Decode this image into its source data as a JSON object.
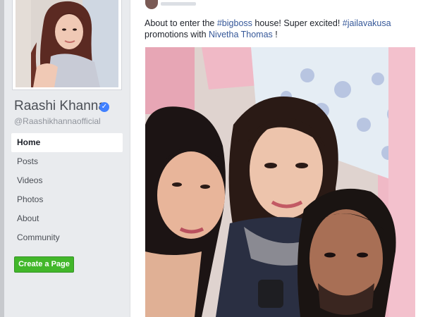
{
  "profile": {
    "name": "Raashi Khanna",
    "handle": "@Raashikhannaofficial",
    "verified_icon": "verified-badge-icon"
  },
  "nav": {
    "items": [
      {
        "label": "Home",
        "active": true
      },
      {
        "label": "Posts"
      },
      {
        "label": "Videos"
      },
      {
        "label": "Photos"
      },
      {
        "label": "About"
      },
      {
        "label": "Community"
      }
    ]
  },
  "actions": {
    "create_page": "Create a Page"
  },
  "post": {
    "text_prefix": "About to enter the ",
    "hashtag1": "#bigboss",
    "text_mid": " house! Super excited! ",
    "hashtag2": "#jailavakusa",
    "text_line2": "promotions with ",
    "mention": "Nivetha Thomas",
    "text_end": " !"
  },
  "colors": {
    "background": "#e9ebee",
    "link": "#365899",
    "button_green": "#42b72a",
    "verified_blue": "#4080ff"
  }
}
